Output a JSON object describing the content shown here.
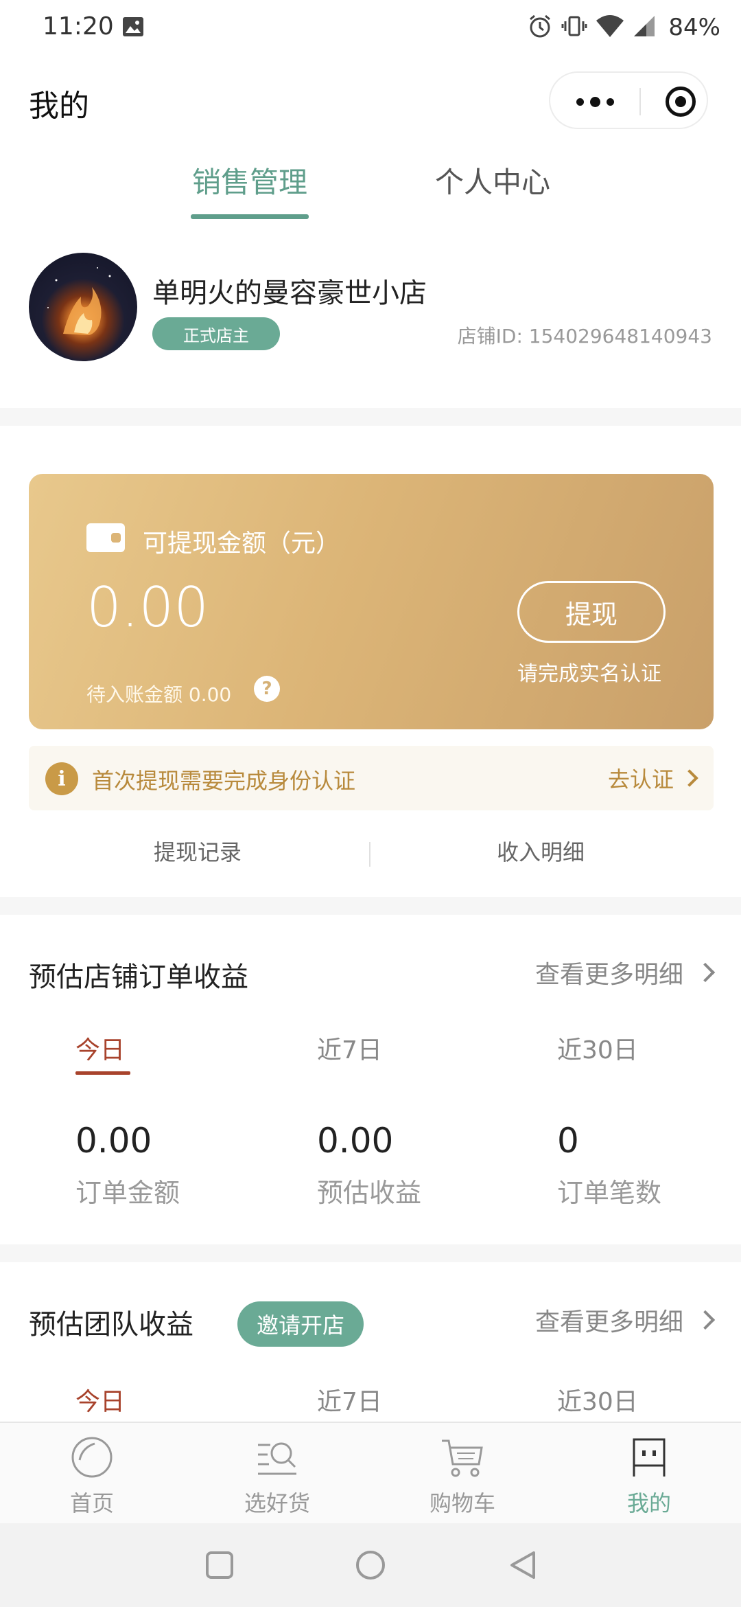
{
  "status_bar": {
    "time": "11:20",
    "battery": "84%",
    "icons": [
      "image-icon",
      "alarm-icon",
      "vibrate-icon",
      "wifi-icon",
      "signal-icon"
    ]
  },
  "header": {
    "title": "我的"
  },
  "top_tabs": [
    {
      "label": "销售管理",
      "active": true
    },
    {
      "label": "个人中心",
      "active": false
    }
  ],
  "profile": {
    "shop_name": "单明火的曼容豪世小店",
    "badge": "正式店主",
    "shop_id": "店铺ID: 154029648140943"
  },
  "balance": {
    "label": "可提现金额（元）",
    "amount": "0.00",
    "pending": "待入账金额 0.00",
    "help": "?",
    "withdraw_button": "提现",
    "verify_hint": "请完成实名认证"
  },
  "notice": {
    "icon_text": "i",
    "text": "首次提现需要完成身份认证",
    "link": "去认证"
  },
  "records": {
    "withdraw_record": "提现记录",
    "income_detail": "收入明细"
  },
  "shop_earnings": {
    "title": "预估店铺订单收益",
    "more": "查看更多明细",
    "periods": [
      "今日",
      "近7日",
      "近30日"
    ],
    "active_period": 0,
    "stats": [
      {
        "value": "0.00",
        "label": "订单金额"
      },
      {
        "value": "0.00",
        "label": "预估收益"
      },
      {
        "value": "0",
        "label": "订单笔数"
      }
    ]
  },
  "team_earnings": {
    "title": "预估团队收益",
    "invite": "邀请开店",
    "more": "查看更多明细",
    "periods": [
      "今日",
      "近7日",
      "近30日"
    ],
    "active_period": 0
  },
  "bottom_nav": [
    {
      "label": "首页",
      "icon": "home-icon",
      "active": false
    },
    {
      "label": "选好货",
      "icon": "search-goods-icon",
      "active": false
    },
    {
      "label": "购物车",
      "icon": "cart-icon",
      "active": false
    },
    {
      "label": "我的",
      "icon": "profile-icon",
      "active": true
    }
  ],
  "colors": {
    "primary_green": "#6aaa95",
    "tab_green": "#5f9e8b",
    "gold": "#dcb577",
    "notice_gold": "#b88a3c",
    "period_red": "#a8432c"
  }
}
